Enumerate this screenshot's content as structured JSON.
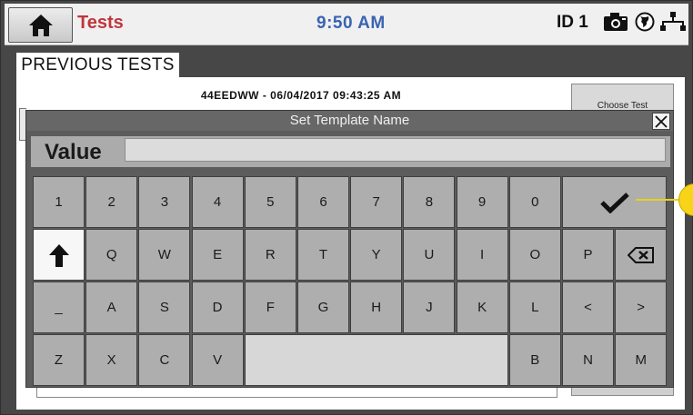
{
  "header": {
    "title": "Tests",
    "time": "9:50 AM",
    "id_label": "ID 1",
    "icons": [
      "home-icon",
      "camera-icon",
      "globe-icon",
      "network-icon"
    ]
  },
  "tab": {
    "label": "PREVIOUS TESTS"
  },
  "test_list": {
    "selected_header": "44EEDWW - 06/04/2017 09:43:25 AM",
    "choose_test_label": "Choose Test"
  },
  "dialog": {
    "title": "Set Template Name",
    "value_label": "Value",
    "value_text": ""
  },
  "keyboard": {
    "rows": [
      [
        "1",
        "2",
        "3",
        "4",
        "5",
        "6",
        "7",
        "8",
        "9",
        "0"
      ],
      [
        "Q",
        "W",
        "E",
        "R",
        "T",
        "Y",
        "U",
        "I",
        "O",
        "P"
      ],
      [
        "A",
        "S",
        "D",
        "F",
        "G",
        "H",
        "J",
        "K",
        "L",
        "<",
        ">"
      ],
      [
        "Z",
        "X",
        "C",
        "V",
        "B",
        "N",
        "M"
      ]
    ],
    "row3_prefix": "_",
    "enter_icon": "check-icon",
    "shift_icon": "up-arrow-icon",
    "backspace_icon": "backspace-icon"
  },
  "colors": {
    "title_red": "#c0363c",
    "time_blue": "#3a63b3",
    "callout_yellow": "#f7d417"
  }
}
